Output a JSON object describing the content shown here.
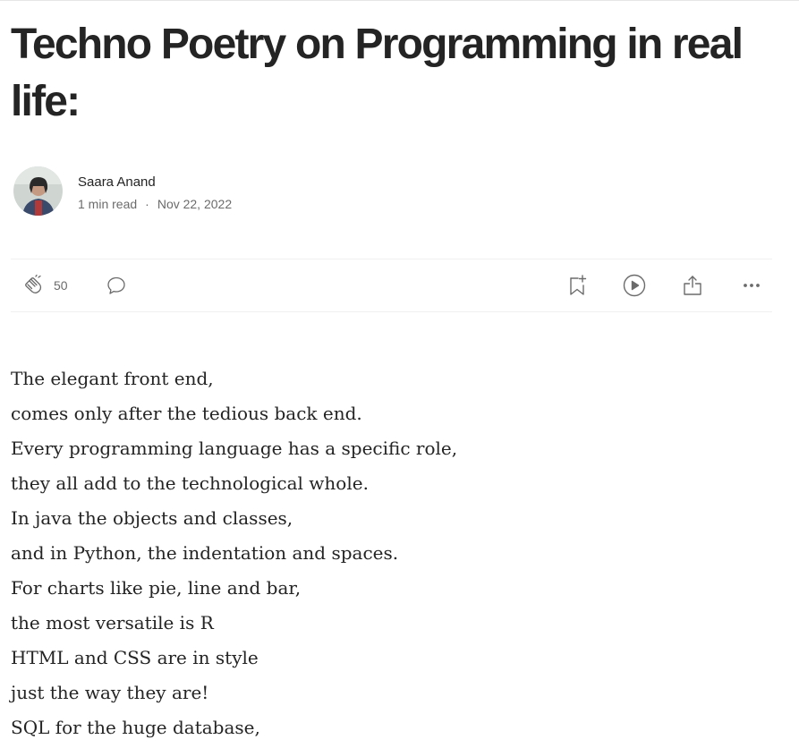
{
  "article": {
    "title": "Techno Poetry on Programming in real life:",
    "author": {
      "name": "Saara Anand",
      "read_time": "1 min read",
      "separator": "·",
      "date": "Nov 22, 2022"
    }
  },
  "actions": {
    "clap_count": "50",
    "icons": [
      "clap-icon",
      "response-icon",
      "bookmark-icon",
      "play-icon",
      "share-icon",
      "more-icon"
    ]
  },
  "body": {
    "lines": [
      "The elegant front end,",
      "comes only after the tedious back end.",
      "Every programming language has a specific role,",
      "they all add to the technological whole.",
      "In java the objects and classes,",
      "and in Python, the indentation and spaces.",
      "For charts like pie, line and bar,",
      "the most versatile is R",
      "HTML and CSS are in style",
      "just the way they are!",
      "SQL for the huge database,"
    ]
  },
  "colors": {
    "text": "#242424",
    "muted": "#6b6b6b",
    "rule": "#f0f0f0"
  }
}
